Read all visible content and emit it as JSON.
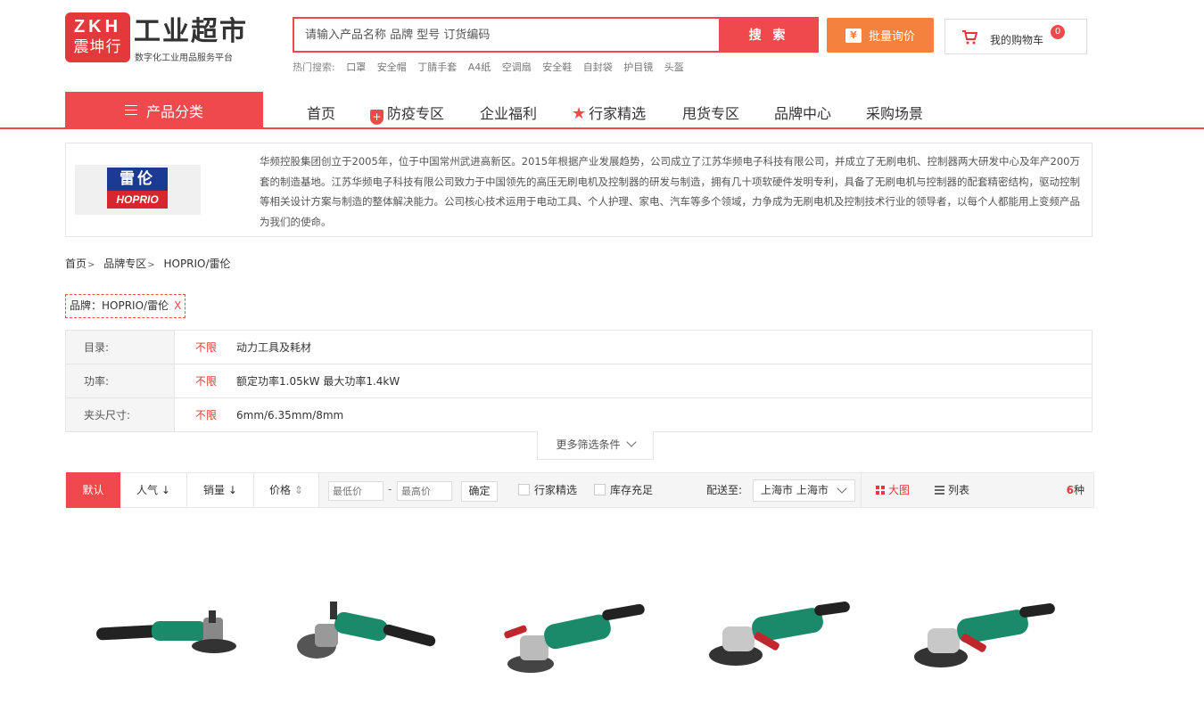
{
  "header": {
    "logo_top": "ZKH",
    "logo_bottom": "震坤行",
    "title": "工业超市",
    "subtitle": "数字化工业用品服务平台",
    "search_placeholder": "请输入产品名称 品牌 型号 订货编码",
    "search_button": "搜 索",
    "hot_label": "热门搜索:",
    "hot_items": [
      "口罩",
      "安全帽",
      "丁腈手套",
      "A4纸",
      "空调扇",
      "安全鞋",
      "自封袋",
      "护目镜",
      "头盔"
    ],
    "bulk_inquiry": "批量询价",
    "bulk_icon": "¥",
    "cart_label": "我的购物车",
    "cart_count": "0"
  },
  "nav": {
    "category_button": "产品分类",
    "items": [
      "首页",
      "防疫专区",
      "企业福利",
      "行家精选",
      "甩货专区",
      "品牌中心",
      "采购场景"
    ]
  },
  "brand": {
    "logo_cn": "雷伦",
    "logo_en": "HOPRIO",
    "description": "华频控股集团创立于2005年，位于中国常州武进高新区。2015年根据产业发展趋势，公司成立了江苏华频电子科技有限公司，并成立了无刷电机、控制器两大研发中心及年产200万套的制造基地。江苏华频电子科技有限公司致力于中国领先的高压无刷电机及控制器的研发与制造，拥有几十项软硬件发明专利，具备了无刷电机与控制器的配套精密结构，驱动控制等相关设计方案与制造的整体解决能力。公司核心技术运用于电动工具、个人护理、家电、汽车等多个领域，力争成为无刷电机及控制技术行业的领导者，以每个人都能用上变频产品为我们的使命。"
  },
  "breadcrumb": [
    "首页",
    "品牌专区",
    "HOPRIO/雷伦"
  ],
  "active_filter": {
    "label": "品牌：HOPRIO/雷伦",
    "remove": "X"
  },
  "filters": [
    {
      "label": "目录:",
      "any": "不限",
      "value": "动力工具及耗材"
    },
    {
      "label": "功率:",
      "any": "不限",
      "value": "额定功率1.05kW 最大功率1.4kW"
    },
    {
      "label": "夹头尺寸:",
      "any": "不限",
      "value": "6mm/6.35mm/8mm"
    }
  ],
  "more_filters": "更多筛选条件",
  "sortbar": {
    "default": "默认",
    "popularity": "人气",
    "sales": "销量",
    "price": "价格",
    "min_price": "最低价",
    "max_price": "最高价",
    "dash": "-",
    "confirm": "确定",
    "expert_pick": "行家精选",
    "in_stock": "库存充足",
    "ship_to_label": "配送至:",
    "ship_to": "上海市 上海市",
    "view_big": "大图",
    "view_list": "列表",
    "count_num": "6",
    "count_unit": "种"
  },
  "colors": {
    "brand_red": "#f0494d",
    "orange": "#f5813e",
    "tool_green": "#1b8a6b"
  }
}
